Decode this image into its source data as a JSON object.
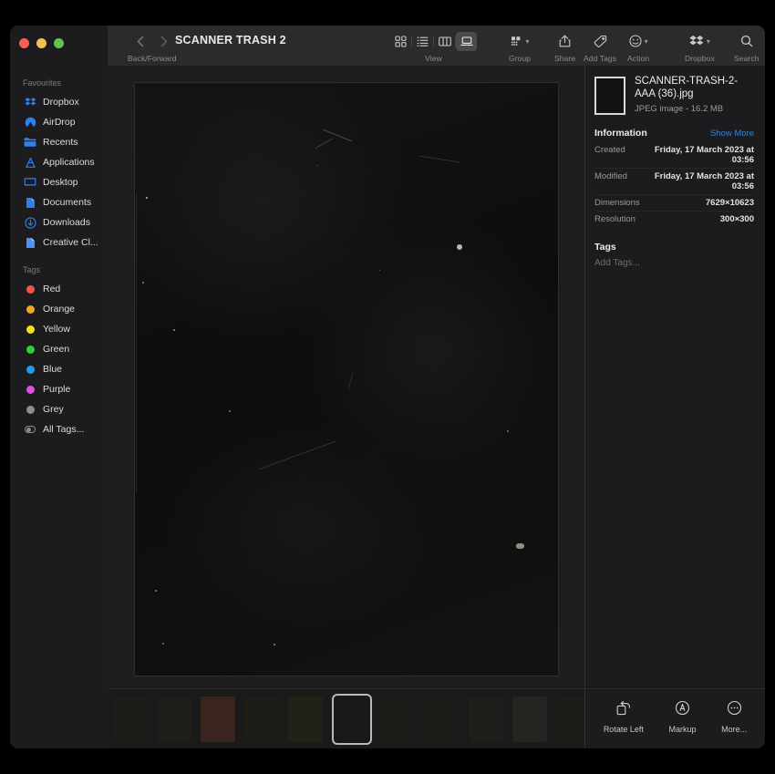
{
  "window": {
    "title": "SCANNER TRASH 2",
    "traffic_lights": [
      "close",
      "minimize",
      "zoom"
    ]
  },
  "toolbar": {
    "nav_caption": "Back/Forward",
    "back_icon": "chevron-left-icon",
    "forward_icon": "chevron-right-icon",
    "view": {
      "caption": "View",
      "options": [
        {
          "id": "icon-view",
          "icon": "grid-icon",
          "active": false
        },
        {
          "id": "list-view",
          "icon": "list-icon",
          "active": false
        },
        {
          "id": "column-view",
          "icon": "columns-icon",
          "active": false
        },
        {
          "id": "gallery-view",
          "icon": "gallery-icon",
          "active": true
        }
      ]
    },
    "group": {
      "caption": "Group",
      "icon": "group-icon"
    },
    "share": {
      "caption": "Share",
      "icon": "share-icon"
    },
    "add_tags": {
      "caption": "Add Tags",
      "icon": "tag-icon"
    },
    "action": {
      "caption": "Action",
      "icon": "action-circle-icon"
    },
    "dropbox": {
      "caption": "Dropbox",
      "icon": "dropbox-icon"
    },
    "search": {
      "caption": "Search",
      "icon": "search-icon"
    }
  },
  "sidebar": {
    "sections": [
      {
        "header": "Favourites",
        "items": [
          {
            "label": "Dropbox",
            "icon": "dropbox-icon",
            "color": "#2f7ff0"
          },
          {
            "label": "AirDrop",
            "icon": "airdrop-icon",
            "color": "#2f7ff0"
          },
          {
            "label": "Recents",
            "icon": "clock-folder-icon",
            "color": "#2f7ff0"
          },
          {
            "label": "Applications",
            "icon": "applications-icon",
            "color": "#2f7ff0"
          },
          {
            "label": "Desktop",
            "icon": "desktop-icon",
            "color": "#2f7ff0"
          },
          {
            "label": "Documents",
            "icon": "documents-icon",
            "color": "#2f7ff0"
          },
          {
            "label": "Downloads",
            "icon": "downloads-icon",
            "color": "#2f7ff0"
          },
          {
            "label": "Creative Cl...",
            "icon": "creative-cloud-icon",
            "color": "#2f7ff0"
          }
        ]
      },
      {
        "header": "Tags",
        "items": [
          {
            "label": "Red",
            "icon": "tag-dot-icon",
            "color": "#f4524d"
          },
          {
            "label": "Orange",
            "icon": "tag-dot-icon",
            "color": "#f5a623"
          },
          {
            "label": "Yellow",
            "icon": "tag-dot-icon",
            "color": "#f6e017"
          },
          {
            "label": "Green",
            "icon": "tag-dot-icon",
            "color": "#2fd02f"
          },
          {
            "label": "Blue",
            "icon": "tag-dot-icon",
            "color": "#1f9cf0"
          },
          {
            "label": "Purple",
            "icon": "tag-dot-icon",
            "color": "#e050e8"
          },
          {
            "label": "Grey",
            "icon": "tag-dot-icon",
            "color": "#8e8e90"
          },
          {
            "label": "All Tags...",
            "icon": "all-tags-icon",
            "color": "#8e8e90"
          }
        ]
      }
    ]
  },
  "info": {
    "file_name": "SCANNER-TRASH-2-AAA (36).jpg",
    "file_meta": "JPEG image - 16.2 MB",
    "section_title": "Information",
    "show_more": "Show More",
    "rows": [
      {
        "key": "Created",
        "value": "Friday, 17 March 2023 at 03:56"
      },
      {
        "key": "Modified",
        "value": "Friday, 17 March 2023 at 03:56"
      },
      {
        "key": "Dimensions",
        "value": "7629×10623"
      },
      {
        "key": "Resolution",
        "value": "300×300"
      }
    ],
    "tags_title": "Tags",
    "add_tags_placeholder": "Add Tags..."
  },
  "quick_actions": [
    {
      "label": "Rotate Left",
      "icon": "rotate-left-icon"
    },
    {
      "label": "Markup",
      "icon": "markup-icon"
    },
    {
      "label": "More...",
      "icon": "more-icon"
    }
  ],
  "filmstrip": {
    "thumbs": [
      {
        "selected": false,
        "tint": "#1c1c18"
      },
      {
        "selected": false,
        "tint": "#1e1e19"
      },
      {
        "selected": false,
        "tint": "#3a2420"
      },
      {
        "selected": false,
        "tint": "#1d1d18"
      },
      {
        "selected": false,
        "tint": "#212118"
      },
      {
        "selected": true,
        "tint": "#161616"
      },
      {
        "selected": false,
        "tint": "#1b1b17"
      },
      {
        "selected": false,
        "tint": "#1a1a16"
      },
      {
        "selected": false,
        "tint": "#1d1d19"
      },
      {
        "selected": false,
        "tint": "#232320"
      },
      {
        "selected": false,
        "tint": "#1c1c18"
      },
      {
        "selected": false,
        "tint": "#212119"
      },
      {
        "selected": false,
        "tint": "#1a1a17"
      }
    ]
  },
  "colors": {
    "accent": "#3b82d6",
    "window_bg": "#1e1e1e",
    "sidebar_bg": "#1c1c1e",
    "toolbar_bg": "#2b2b2b"
  }
}
